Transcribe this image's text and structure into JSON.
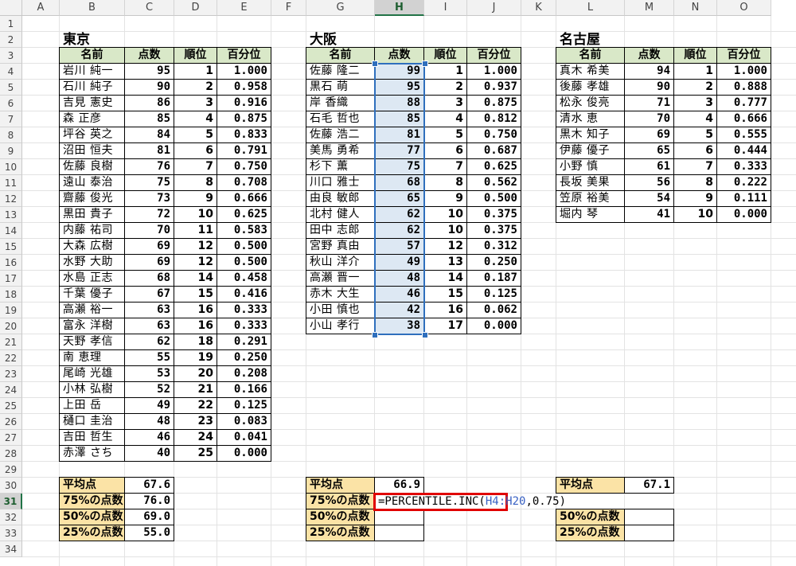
{
  "columns": [
    "A",
    "B",
    "C",
    "D",
    "E",
    "F",
    "G",
    "H",
    "I",
    "J",
    "K",
    "L",
    "M",
    "N",
    "O"
  ],
  "rows": [
    "1",
    "2",
    "3",
    "4",
    "5",
    "6",
    "7",
    "8",
    "9",
    "10",
    "11",
    "12",
    "13",
    "14",
    "15",
    "16",
    "17",
    "18",
    "19",
    "20",
    "21",
    "22",
    "23",
    "24",
    "25",
    "26",
    "27",
    "28",
    "29",
    "30",
    "31",
    "32",
    "33",
    "34"
  ],
  "selected_column": "H",
  "selected_row": "31",
  "headers": [
    "名前",
    "点数",
    "順位",
    "百分位"
  ],
  "tokyo": {
    "title": "東京",
    "rows": [
      [
        "岩川 純一",
        "95",
        "1",
        "1.000"
      ],
      [
        "石川 純子",
        "90",
        "2",
        "0.958"
      ],
      [
        "吉見 憲史",
        "86",
        "3",
        "0.916"
      ],
      [
        "森 正彦",
        "85",
        "4",
        "0.875"
      ],
      [
        "坪谷 英之",
        "84",
        "5",
        "0.833"
      ],
      [
        "沼田 恒夫",
        "81",
        "6",
        "0.791"
      ],
      [
        "佐藤 良樹",
        "76",
        "7",
        "0.750"
      ],
      [
        "遠山 泰治",
        "75",
        "8",
        "0.708"
      ],
      [
        "齋藤 俊光",
        "73",
        "9",
        "0.666"
      ],
      [
        "黒田 貴子",
        "72",
        "10",
        "0.625"
      ],
      [
        "内藤 祐司",
        "70",
        "11",
        "0.583"
      ],
      [
        "大森 広樹",
        "69",
        "12",
        "0.500"
      ],
      [
        "水野 大助",
        "69",
        "12",
        "0.500"
      ],
      [
        "水島 正志",
        "68",
        "14",
        "0.458"
      ],
      [
        "千葉 優子",
        "67",
        "15",
        "0.416"
      ],
      [
        "高瀬 裕一",
        "63",
        "16",
        "0.333"
      ],
      [
        "富永 洋樹",
        "63",
        "16",
        "0.333"
      ],
      [
        "天野 孝信",
        "62",
        "18",
        "0.291"
      ],
      [
        "南 恵理",
        "55",
        "19",
        "0.250"
      ],
      [
        "尾崎 光雄",
        "53",
        "20",
        "0.208"
      ],
      [
        "小林 弘樹",
        "52",
        "21",
        "0.166"
      ],
      [
        "上田 岳",
        "49",
        "22",
        "0.125"
      ],
      [
        "樋口 圭治",
        "48",
        "23",
        "0.083"
      ],
      [
        "吉田 哲生",
        "46",
        "24",
        "0.041"
      ],
      [
        "赤澤 さち",
        "40",
        "25",
        "0.000"
      ]
    ],
    "stats": [
      [
        "平均点",
        "67.6"
      ],
      [
        "75%の点数",
        "76.0"
      ],
      [
        "50%の点数",
        "69.0"
      ],
      [
        "25%の点数",
        "55.0"
      ]
    ]
  },
  "osaka": {
    "title": "大阪",
    "rows": [
      [
        "佐藤 隆二",
        "99",
        "1",
        "1.000"
      ],
      [
        "黒石 萌",
        "95",
        "2",
        "0.937"
      ],
      [
        "岸 香織",
        "88",
        "3",
        "0.875"
      ],
      [
        "石毛 哲也",
        "85",
        "4",
        "0.812"
      ],
      [
        "佐藤 浩二",
        "81",
        "5",
        "0.750"
      ],
      [
        "美馬 勇希",
        "77",
        "6",
        "0.687"
      ],
      [
        "杉下 薫",
        "75",
        "7",
        "0.625"
      ],
      [
        "川口 雅士",
        "68",
        "8",
        "0.562"
      ],
      [
        "由良 敏郎",
        "65",
        "9",
        "0.500"
      ],
      [
        "北村 健人",
        "62",
        "10",
        "0.375"
      ],
      [
        "田中 志郎",
        "62",
        "10",
        "0.375"
      ],
      [
        "宮野 真由",
        "57",
        "12",
        "0.312"
      ],
      [
        "秋山 洋介",
        "49",
        "13",
        "0.250"
      ],
      [
        "高瀬 晋一",
        "48",
        "14",
        "0.187"
      ],
      [
        "赤木 大生",
        "46",
        "15",
        "0.125"
      ],
      [
        "小田 慎也",
        "42",
        "16",
        "0.062"
      ],
      [
        "小山 孝行",
        "38",
        "17",
        "0.000"
      ]
    ],
    "stats": [
      [
        "平均点",
        "66.9"
      ],
      [
        "75%の点数",
        ""
      ],
      [
        "50%の点数",
        ""
      ],
      [
        "25%の点数",
        ""
      ]
    ],
    "formula": {
      "prefix": "=PERCENTILE.INC(",
      "ref": "H4:H20",
      "suffix": ",0.75)"
    }
  },
  "nagoya": {
    "title": "名古屋",
    "rows": [
      [
        "真木 希美",
        "94",
        "1",
        "1.000"
      ],
      [
        "後藤 孝雄",
        "90",
        "2",
        "0.888"
      ],
      [
        "松永 俊亮",
        "71",
        "3",
        "0.777"
      ],
      [
        "清水 恵",
        "70",
        "4",
        "0.666"
      ],
      [
        "黒木 知子",
        "69",
        "5",
        "0.555"
      ],
      [
        "伊藤 優子",
        "65",
        "6",
        "0.444"
      ],
      [
        "小野 慎",
        "61",
        "7",
        "0.333"
      ],
      [
        "長坂 美果",
        "56",
        "8",
        "0.222"
      ],
      [
        "笠原 裕美",
        "54",
        "9",
        "0.111"
      ],
      [
        "堀内 琴",
        "41",
        "10",
        "0.000"
      ]
    ],
    "stats": [
      [
        "平均点",
        "67.1"
      ],
      [
        "",
        ""
      ],
      [
        "50%の点数",
        ""
      ],
      [
        "25%の点数",
        ""
      ]
    ]
  }
}
